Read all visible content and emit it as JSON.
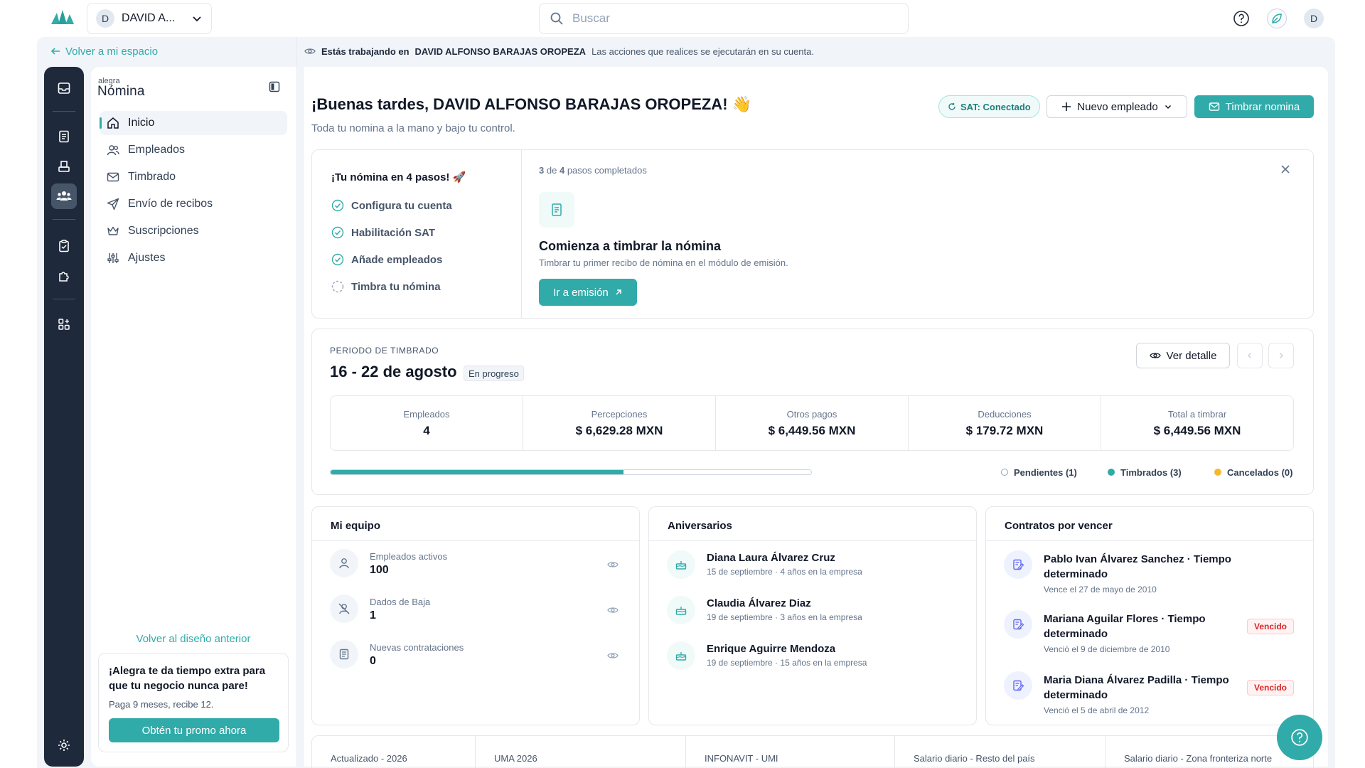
{
  "topbar": {
    "account_initial": "D",
    "account_name": "DAVID A...",
    "search_placeholder": "Buscar",
    "user_initial": "D"
  },
  "frame": {
    "back_link": "Volver a mi espacio",
    "banner_prefix": "Estás trabajando en",
    "banner_name": "DAVID ALFONSO BARAJAS OROPEZA",
    "banner_suffix": "Las acciones que realices se ejecutarán en su cuenta."
  },
  "sidebar": {
    "brand_small": "alegra",
    "brand": "Nómina",
    "items": [
      {
        "label": "Inicio"
      },
      {
        "label": "Empleados"
      },
      {
        "label": "Timbrado"
      },
      {
        "label": "Envío de recibos"
      },
      {
        "label": "Suscripciones"
      },
      {
        "label": "Ajustes"
      }
    ],
    "previous_design": "Volver al diseño anterior",
    "promo_title": "¡Alegra te da tiempo extra para que tu negocio nunca pare!",
    "promo_sub": "Paga 9 meses, recibe 12.",
    "promo_button": "Obtén tu promo ahora"
  },
  "header": {
    "greeting": "¡Buenas tardes, DAVID ALFONSO BARAJAS OROPEZA! 👋",
    "subtitle": "Toda tu nomina a la mano y bajo tu control.",
    "sat_badge": "SAT: Conectado",
    "new_employee": "Nuevo empleado",
    "stamp_payroll": "Timbrar nomina"
  },
  "steps": {
    "title": "¡Tu nómina en 4 pasos! 🚀",
    "items": [
      {
        "label": "Configura tu cuenta",
        "done": true
      },
      {
        "label": "Habilitación SAT",
        "done": true
      },
      {
        "label": "Añade empleados",
        "done": true
      },
      {
        "label": "Timbra tu nómina",
        "done": false
      }
    ],
    "completed": "3",
    "of_word": "de",
    "total": "4",
    "completed_suffix": "pasos completados",
    "stage_title": "Comienza a timbrar la nómina",
    "stage_sub": "Timbrar tu primer recibo de nómina en el módulo de emisión.",
    "stage_button": "Ir a emisión"
  },
  "period": {
    "label": "PERIODO DE TIMBRADO",
    "range": "16 - 22 de agosto",
    "status": "En progreso",
    "detail_button": "Ver detalle",
    "stats": [
      {
        "label": "Empleados",
        "value": "4"
      },
      {
        "label": "Percepciones",
        "value": "$ 6,629.28 MXN"
      },
      {
        "label": "Otros pagos",
        "value": "$ 6,449.56 MXN"
      },
      {
        "label": "Deducciones",
        "value": "$ 179.72 MXN"
      },
      {
        "label": "Total a timbrar",
        "value": "$ 6,449.56 MXN"
      }
    ],
    "progress_fraction": 0.61,
    "legend": [
      {
        "label": "Pendientes (1)",
        "color": "#ffffff"
      },
      {
        "label": "Timbrados (3)",
        "color": "#30aba9"
      },
      {
        "label": "Cancelados (0)",
        "color": "#f5b82e"
      }
    ]
  },
  "team": {
    "title": "Mi equipo",
    "rows": [
      {
        "label": "Empleados activos",
        "value": "100"
      },
      {
        "label": "Dados de Baja",
        "value": "1"
      },
      {
        "label": "Nuevas contrataciones",
        "value": "0"
      }
    ]
  },
  "anniversaries": {
    "title": "Aniversarios",
    "rows": [
      {
        "name": "Diana Laura Álvarez Cruz",
        "sub": "15 de septiembre · 4 años en la empresa"
      },
      {
        "name": "Claudia Álvarez Diaz",
        "sub": "19 de septiembre · 3 años en la empresa"
      },
      {
        "name": "Enrique Aguirre Mendoza",
        "sub": "19 de septiembre · 15 años en la empresa"
      }
    ]
  },
  "contracts": {
    "title": "Contratos por vencer",
    "badge": "Vencido",
    "rows": [
      {
        "name": "Pablo Ivan Álvarez Sanchez · Tiempo determinado",
        "sub": "Vence el 27 de mayo de 2010",
        "expired": false
      },
      {
        "name": "Mariana Aguilar Flores · Tiempo determinado",
        "sub": "Venció el 9 de diciembre de 2010",
        "expired": true
      },
      {
        "name": "Maria Diana Álvarez Padilla · Tiempo determinado",
        "sub": "Venció el 5 de abril de 2012",
        "expired": true
      }
    ]
  },
  "indicators": [
    {
      "label": "Actualizado - 2026"
    },
    {
      "label": "UMA 2026"
    },
    {
      "label": "INFONAVIT - UMI"
    },
    {
      "label": "Salario diario - Resto del país"
    },
    {
      "label": "Salario diario - Zona fronteriza norte"
    }
  ],
  "colors": {
    "accent": "#30aba9",
    "rail": "#1e293b",
    "danger": "#dc2626"
  }
}
